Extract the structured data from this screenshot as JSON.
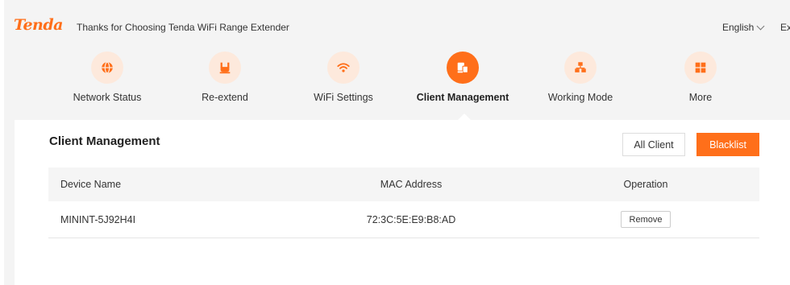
{
  "header": {
    "logo_text": "Tenda",
    "tagline": "Thanks for Choosing Tenda WiFi Range Extender",
    "language": "English",
    "exit_label": "Exit"
  },
  "nav": {
    "items": [
      {
        "label": "Network Status",
        "icon": "globe-icon",
        "active": false
      },
      {
        "label": "Re-extend",
        "icon": "plug-icon",
        "active": false
      },
      {
        "label": "WiFi Settings",
        "icon": "wifi-icon",
        "active": false
      },
      {
        "label": "Client Management",
        "icon": "client-icon",
        "active": true
      },
      {
        "label": "Working Mode",
        "icon": "network-icon",
        "active": false
      },
      {
        "label": "More",
        "icon": "grid-icon",
        "active": false
      }
    ]
  },
  "panel": {
    "title": "Client Management",
    "all_client_label": "All Client",
    "blacklist_label": "Blacklist",
    "table": {
      "columns": [
        "Device Name",
        "MAC Address",
        "Operation"
      ],
      "rows": [
        {
          "device_name": "MININT-5J92H4I",
          "mac": "72:3C:5E:E9:B8:AD",
          "action": "Remove"
        }
      ]
    }
  },
  "colors": {
    "accent": "#ff6f1a",
    "icon_bg": "#fde9dc"
  }
}
